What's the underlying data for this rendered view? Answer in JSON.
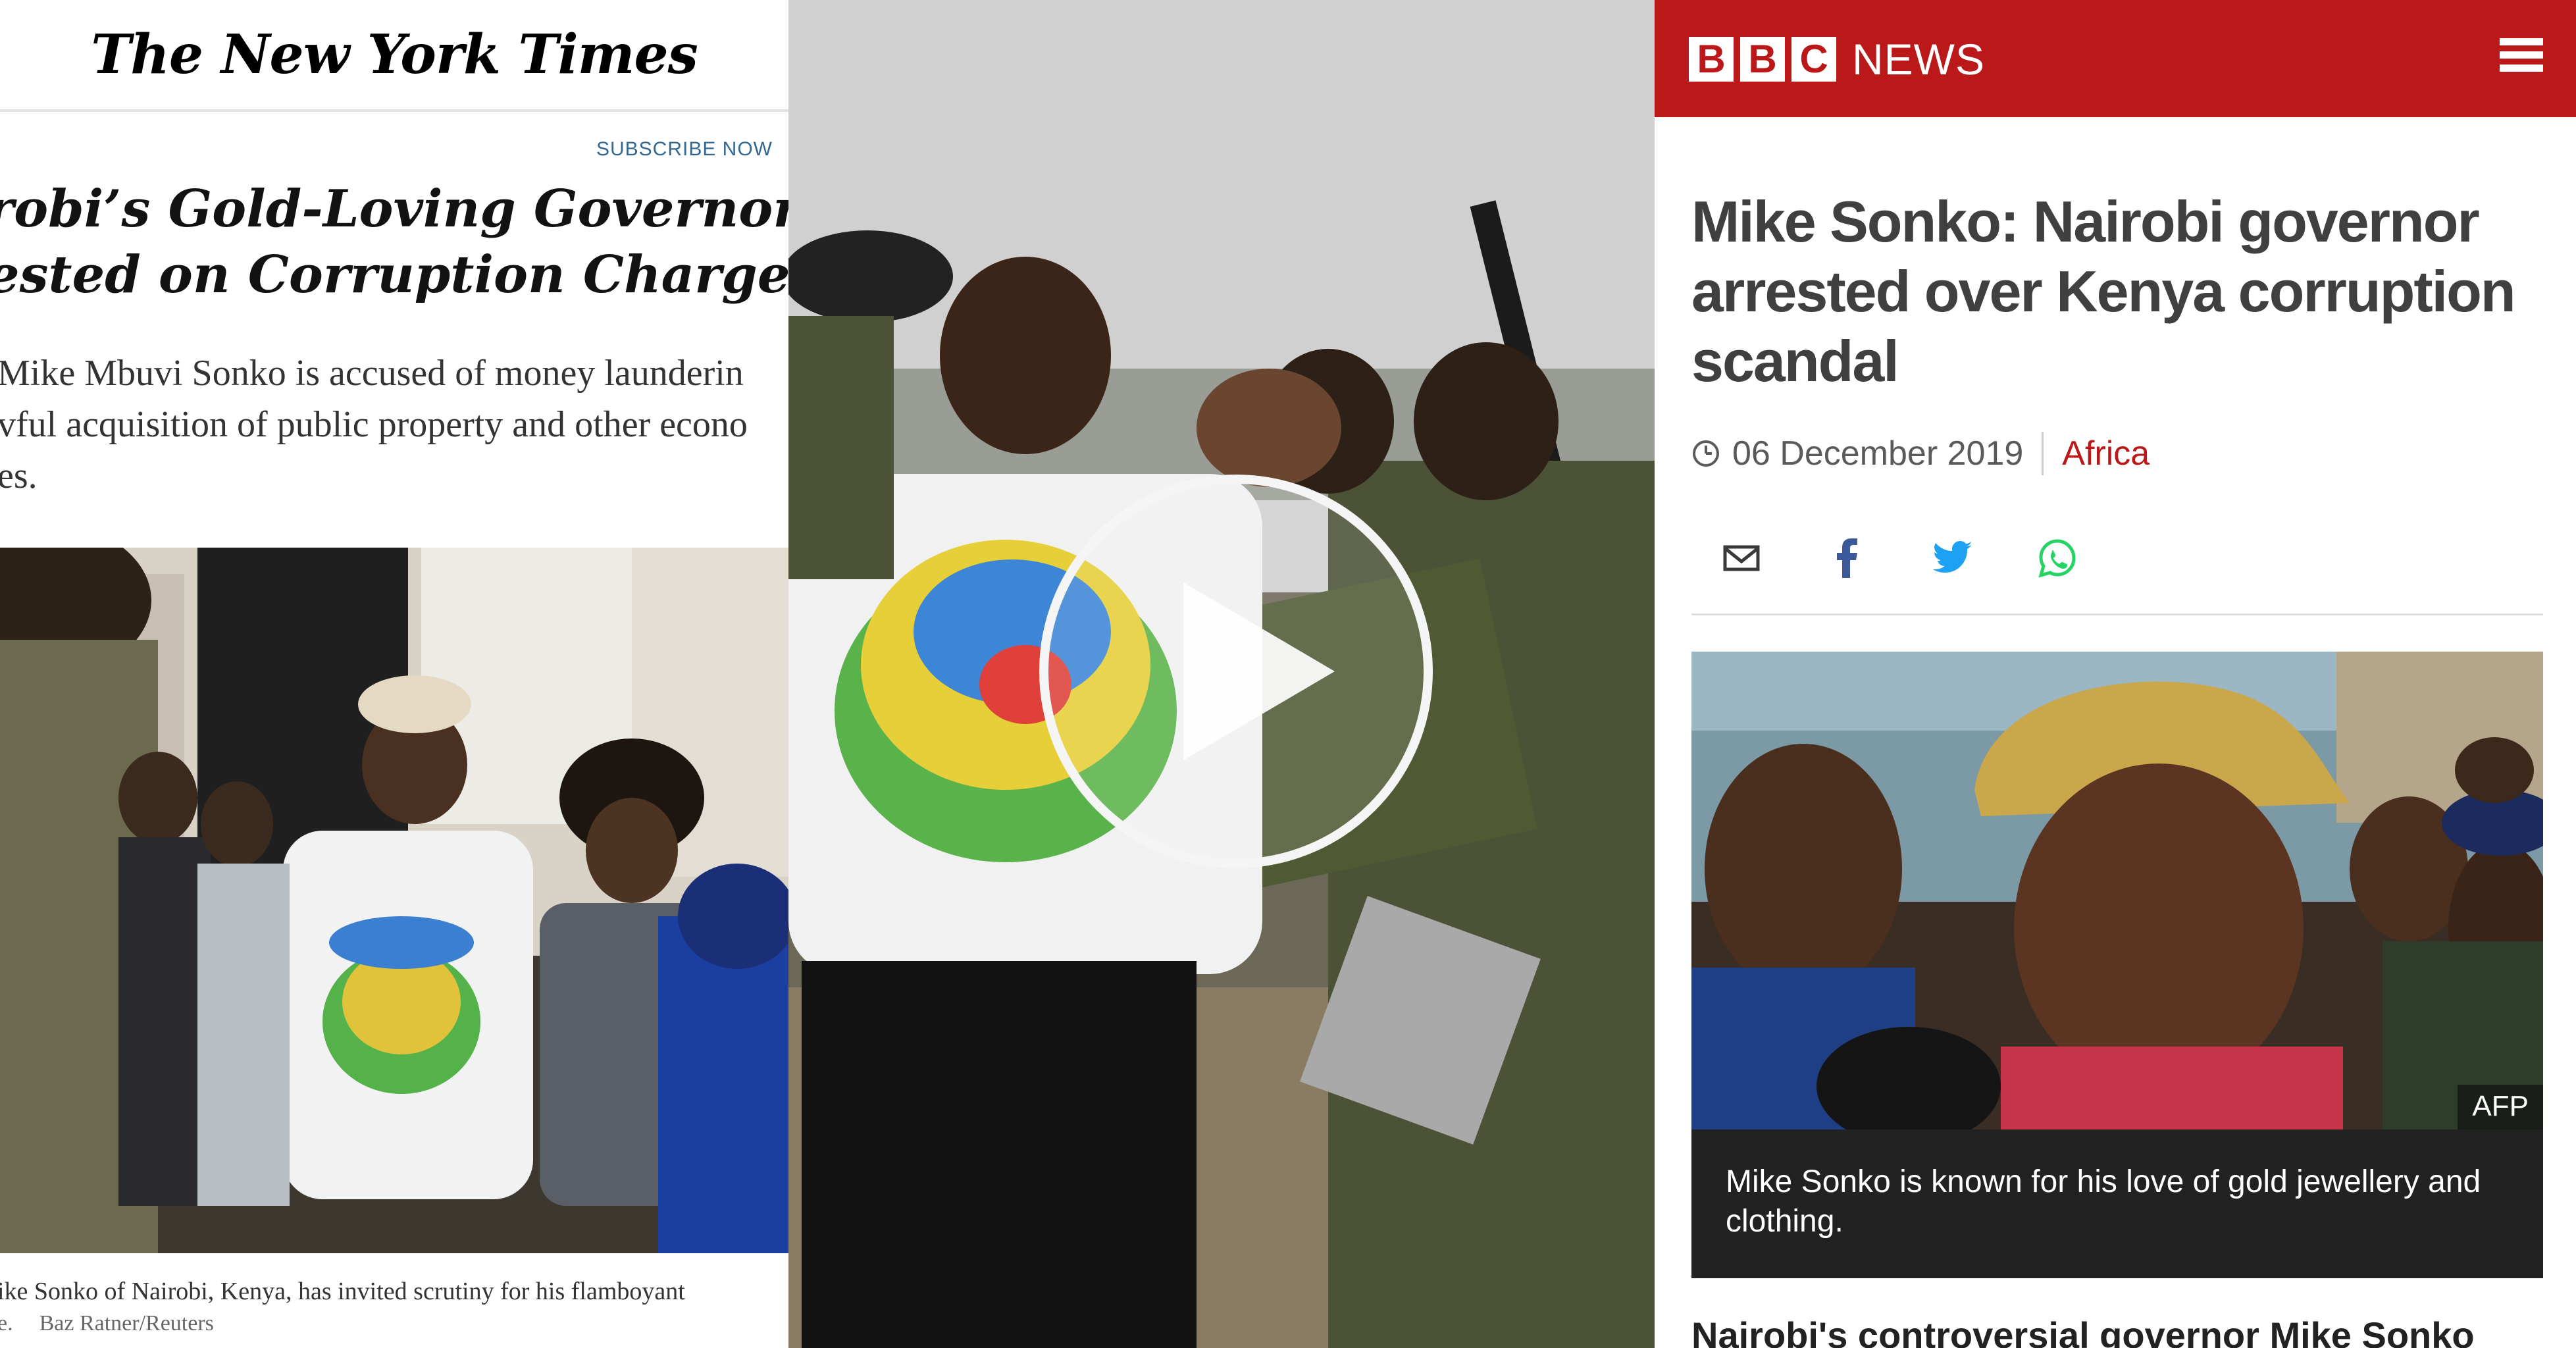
{
  "nyt": {
    "masthead": "The New York Times",
    "subscribe_label": "SUBSCRIBE NOW",
    "headline_lines": [
      "robi’s Gold-Loving Governor Is",
      "ested on Corruption Charges"
    ],
    "summary_lines": [
      "Mike Mbuvi Sonko is accused of money launderin",
      "vful acquisition of public property and other econo",
      "es."
    ],
    "caption": "ike Sonko of Nairobi, Kenya, has invited scrutiny for his flamboyant",
    "credit_prefix": "e.",
    "credit_name": "Baz Ratner/Reuters"
  },
  "video": {
    "play_icon": "play-icon"
  },
  "bbc": {
    "logo_letters": [
      "B",
      "B",
      "C"
    ],
    "logo_word": "NEWS",
    "menu_icon": "hamburger-menu-icon",
    "headline_lines": [
      "Mike Sonko: Nairobi governor",
      "arrested over Kenya corruption",
      "scandal"
    ],
    "date": "06 December 2019",
    "section": "Africa",
    "share_icons": [
      "email-icon",
      "facebook-icon",
      "twitter-icon",
      "whatsapp-icon"
    ],
    "image_credit": "AFP",
    "caption_lines": [
      "Mike Sonko is known for his love of gold jewellery and",
      "clothing."
    ],
    "body_start": "Nairobi's controversial governor Mike Sonko"
  },
  "colors": {
    "bbc_red": "#bb1919",
    "nyt_link_blue": "#326891",
    "caption_bg": "#222222"
  }
}
